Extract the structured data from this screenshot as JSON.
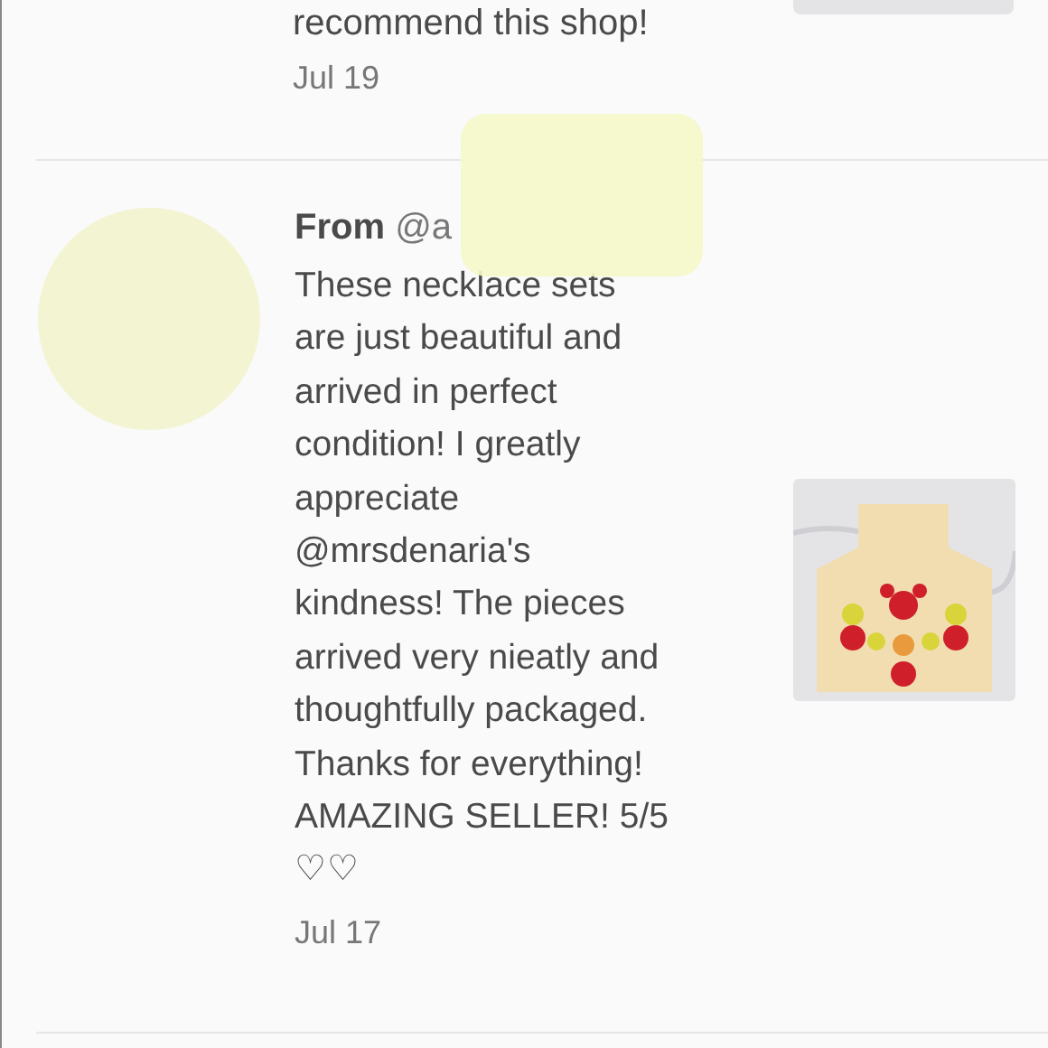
{
  "previous_review": {
    "text": "recommend this shop!",
    "date": "Jul 19"
  },
  "review": {
    "author_prefix": "From",
    "author": "@a",
    "text_lines": [
      "These necklace sets",
      "are just beautiful and",
      "arrived in perfect",
      "condition! I greatly",
      "appreciate",
      "@mrsdenaria's",
      "kindness! The pieces",
      "arrived very nieatly and",
      "thoughtfully packaged.",
      "Thanks for everything!",
      "AMAZING SELLER! 5/5",
      "♡♡"
    ],
    "date": "Jul 17"
  }
}
